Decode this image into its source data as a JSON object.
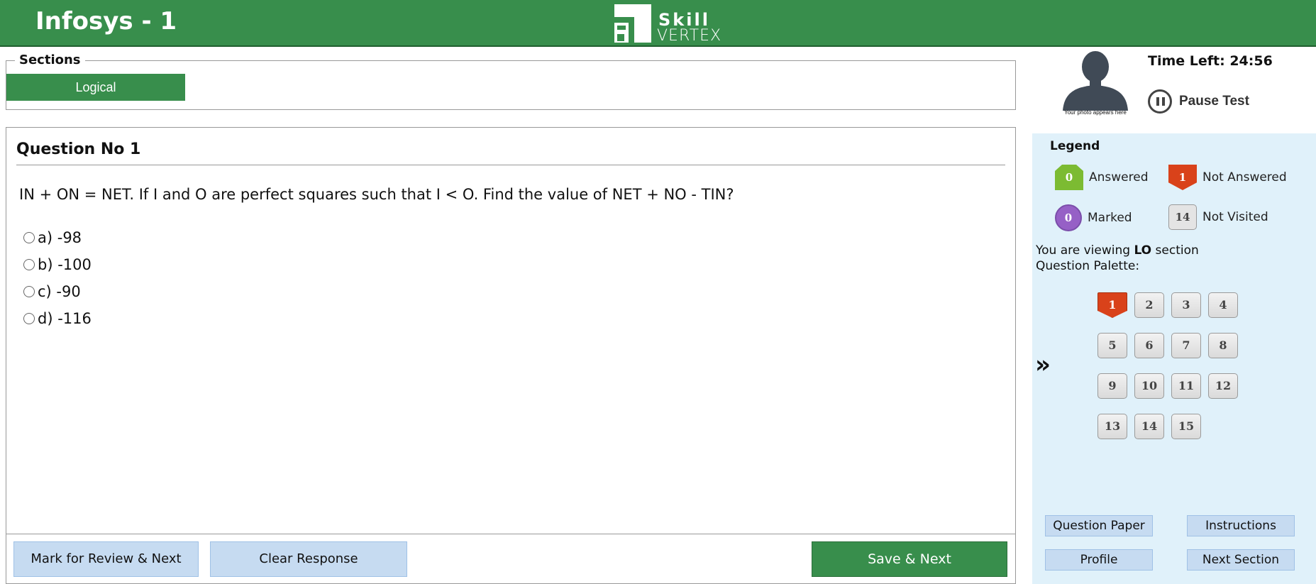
{
  "header": {
    "title": "Infosys - 1",
    "logo_top": "Skill",
    "logo_bottom": "VERTEX"
  },
  "sections": {
    "legend": "Sections",
    "tabs": [
      {
        "label": "Logical",
        "active": true
      }
    ]
  },
  "question": {
    "heading": "Question No 1",
    "text": "IN + ON = NET. If I and O are perfect squares such that I < O. Find the value of NET + NO - TIN?",
    "options": [
      "a) -98",
      "b) -100",
      "c) -90",
      "d) -116"
    ]
  },
  "actions": {
    "review": "Mark for Review & Next",
    "clear": "Clear Response",
    "save": "Save & Next"
  },
  "profile": {
    "photo_caption": "Your photo appears here"
  },
  "timer": {
    "label": "Time Left: 24:56",
    "pause_label": "Pause Test"
  },
  "legend": {
    "title": "Legend",
    "answered": {
      "count": "0",
      "label": "Answered"
    },
    "not_answered": {
      "count": "1",
      "label": "Not Answered"
    },
    "marked": {
      "count": "0",
      "label": "Marked"
    },
    "not_visited": {
      "count": "14",
      "label": "Not Visited"
    }
  },
  "palette": {
    "viewing_prefix": "You are viewing",
    "section_code": "LO",
    "viewing_suffix": "section",
    "title": "Question Palette:",
    "questions": [
      "1",
      "2",
      "3",
      "4",
      "5",
      "6",
      "7",
      "8",
      "9",
      "10",
      "11",
      "12",
      "13",
      "14",
      "15"
    ],
    "current_status": "not-answered"
  },
  "side_buttons": {
    "question_paper": "Question Paper",
    "instructions": "Instructions",
    "profile": "Profile",
    "next_section": "Next Section"
  },
  "colors": {
    "brand_green": "#388e4c",
    "side_panel": "#e0f1fa",
    "light_button": "#c6dbf1",
    "answered": "#7cbb32",
    "not_answered": "#d9421a",
    "marked": "#9660c6"
  }
}
